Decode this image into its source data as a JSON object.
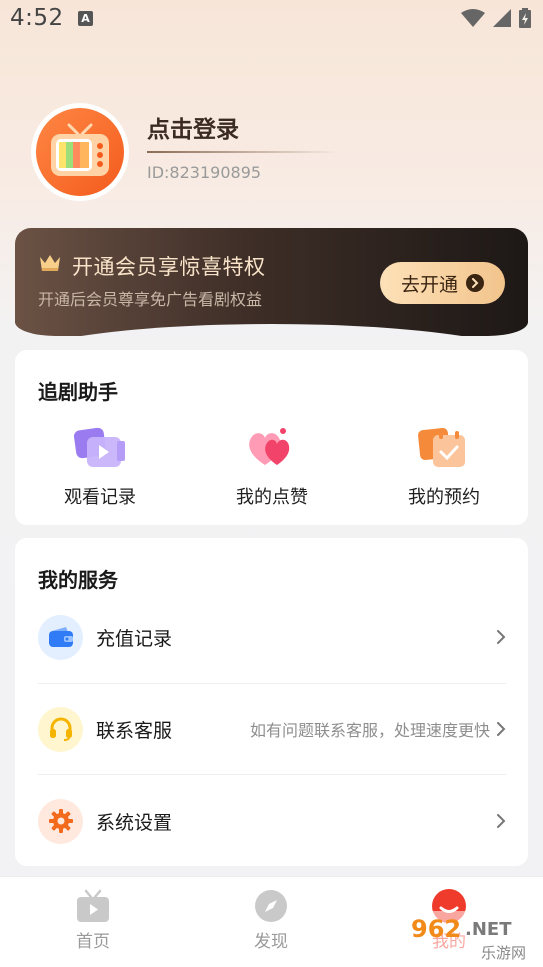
{
  "status_bar": {
    "time": "4:52",
    "notification_letter": "A"
  },
  "profile": {
    "login_label": "点击登录",
    "user_id": "ID:823190895"
  },
  "vip": {
    "title": "开通会员享惊喜特权",
    "subtitle": "开通后会员尊享免广告看剧权益",
    "button_label": "去开通",
    "accent_color": "#f2c48c"
  },
  "assistant": {
    "title": "追剧助手",
    "items": [
      {
        "label": "观看记录",
        "icon": "watch-history-icon"
      },
      {
        "label": "我的点赞",
        "icon": "likes-icon"
      },
      {
        "label": "我的预约",
        "icon": "reservation-icon"
      }
    ]
  },
  "services": {
    "title": "我的服务",
    "items": [
      {
        "label": "充值记录",
        "hint": "",
        "icon": "wallet-icon"
      },
      {
        "label": "联系客服",
        "hint": "如有问题联系客服，处理速度更快",
        "icon": "headset-icon"
      },
      {
        "label": "系统设置",
        "hint": "",
        "icon": "gear-icon"
      }
    ]
  },
  "tabs": [
    {
      "label": "首页",
      "icon": "tv-icon"
    },
    {
      "label": "发现",
      "icon": "compass-icon"
    },
    {
      "label": "我的",
      "icon": "profile-icon",
      "active": true
    }
  ],
  "watermark": {
    "text": "962.NET",
    "sub": "乐游网"
  },
  "colors": {
    "brand_orange": "#f35b1d",
    "active_red": "#ef3b2c"
  }
}
